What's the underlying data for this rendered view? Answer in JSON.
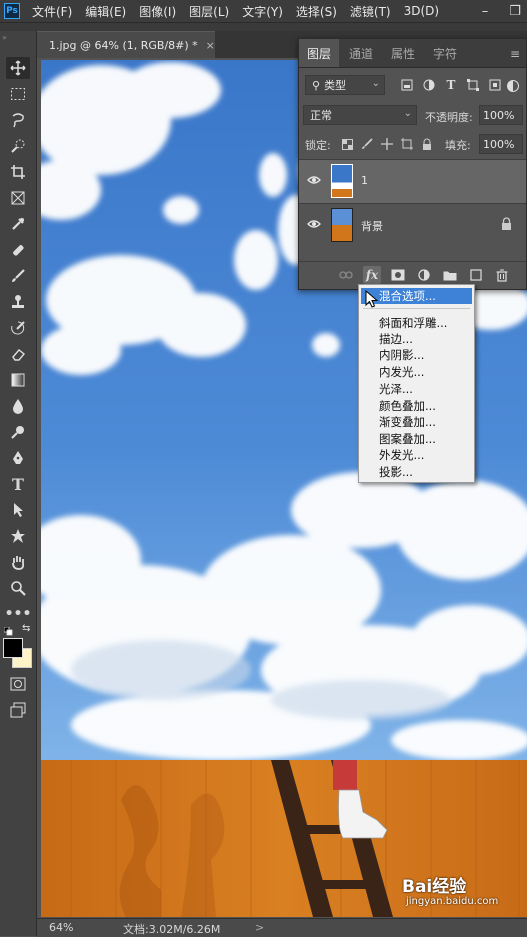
{
  "app": {
    "logo": "Ps"
  },
  "menubar": {
    "items": [
      "文件(F)",
      "编辑(E)",
      "图像(I)",
      "图层(L)",
      "文字(Y)",
      "选择(S)",
      "滤镜(T)",
      "3D(D)"
    ],
    "minimize": "–",
    "maximize": "❐"
  },
  "document": {
    "tab_title": "1.jpg @ 64% (1, RGB/8#) *",
    "close": "×"
  },
  "status": {
    "zoom": "64%",
    "doc_info": "文档:3.02M/6.26M"
  },
  "layers_panel": {
    "tabs": [
      "图层",
      "通道",
      "属性",
      "字符"
    ],
    "filter_label": "类型",
    "blend_mode": "正常",
    "opacity_label": "不透明度:",
    "opacity_value": "100%",
    "lock_label": "锁定:",
    "fill_label": "填充:",
    "fill_value": "100%",
    "layers": [
      {
        "name": "1",
        "selected": true
      },
      {
        "name": "背景",
        "selected": false,
        "locked": true
      }
    ]
  },
  "fx_menu": {
    "items": [
      "混合选项...",
      "斜面和浮雕...",
      "描边...",
      "内阴影...",
      "内发光...",
      "光泽...",
      "颜色叠加...",
      "渐变叠加...",
      "图案叠加...",
      "外发光...",
      "投影..."
    ],
    "highlighted": 0
  },
  "colors": {
    "sky_top": "#3d78c9",
    "sky_bottom": "#7ab0e6",
    "wood": "#d2761c",
    "highlight": "#3d82d6",
    "foreground": "#000000",
    "background": "#fff4c8"
  },
  "watermark": {
    "text": "Bai经验",
    "url": "jingyan.baidu.com"
  }
}
